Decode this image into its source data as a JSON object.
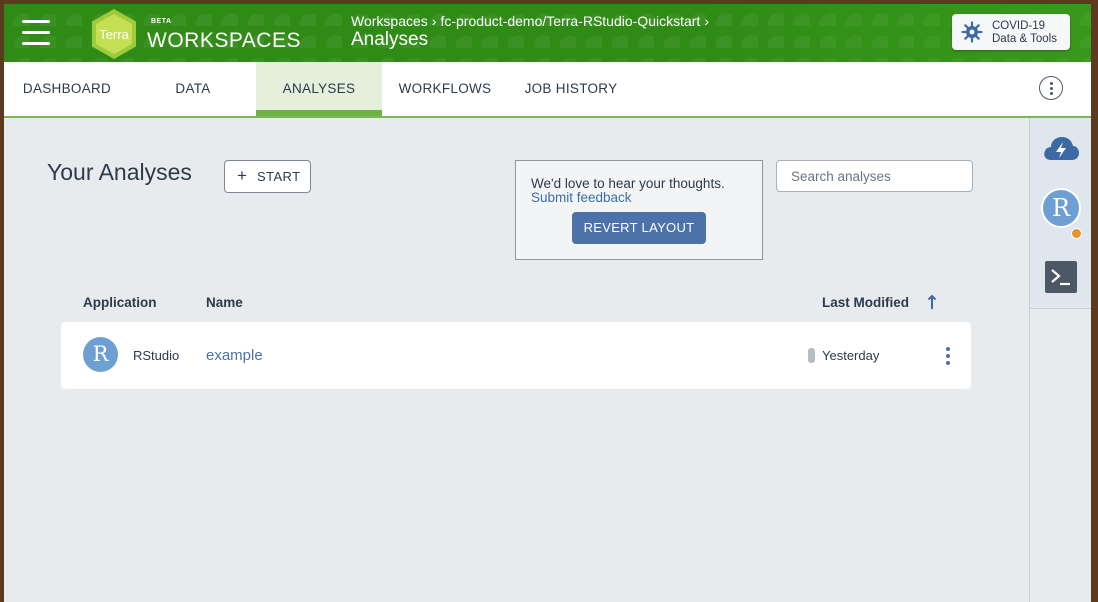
{
  "header": {
    "logo_text": "Terra",
    "beta": "BETA",
    "brand": "WORKSPACES",
    "breadcrumb": {
      "root": "Workspaces",
      "sep1": "›",
      "workspace": "fc-product-demo/Terra-RStudio-Quickstart",
      "sep2": "›"
    },
    "page_title": "Analyses",
    "covid": {
      "line1": "COVID-19",
      "line2": "Data & Tools"
    }
  },
  "tabs": [
    {
      "label": "DASHBOARD",
      "active": false
    },
    {
      "label": "DATA",
      "active": false
    },
    {
      "label": "ANALYSES",
      "active": true
    },
    {
      "label": "WORKFLOWS",
      "active": false
    },
    {
      "label": "JOB HISTORY",
      "active": false
    }
  ],
  "main": {
    "title": "Your Analyses",
    "start_label": "START",
    "start_plus": "+",
    "feedback": {
      "message": "We'd love to hear your thoughts.",
      "link": "Submit feedback",
      "revert_label": "REVERT LAYOUT"
    },
    "search_placeholder": "Search analyses",
    "columns": {
      "application": "Application",
      "name": "Name",
      "last_modified": "Last Modified"
    },
    "rows": [
      {
        "avatar": "R",
        "application": "RStudio",
        "name": "example",
        "modified": "Yesterday"
      }
    ]
  },
  "rail": {
    "avatar": "R"
  },
  "colors": {
    "header_green": "#2f8a16",
    "tab_active_bar": "#6db343",
    "link_blue": "#4d72aa",
    "status_dot": "#e8912d"
  }
}
